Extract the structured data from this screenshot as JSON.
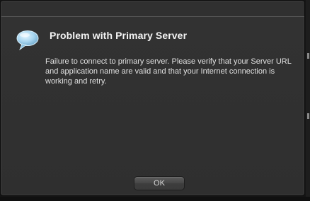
{
  "dialog": {
    "title": "Problem with Primary Server",
    "message": "Failure to connect to primary server. Please verify that your Server URL and application name are valid and that your Internet connection is working and retry.",
    "icon": "speech-bubble-icon",
    "ok_label": "OK"
  },
  "colors": {
    "dialog_background": "#2f2f2f",
    "title_text": "#f4f4f4",
    "body_text": "#e0e0e0",
    "icon_fill": "#a8d6f0"
  }
}
